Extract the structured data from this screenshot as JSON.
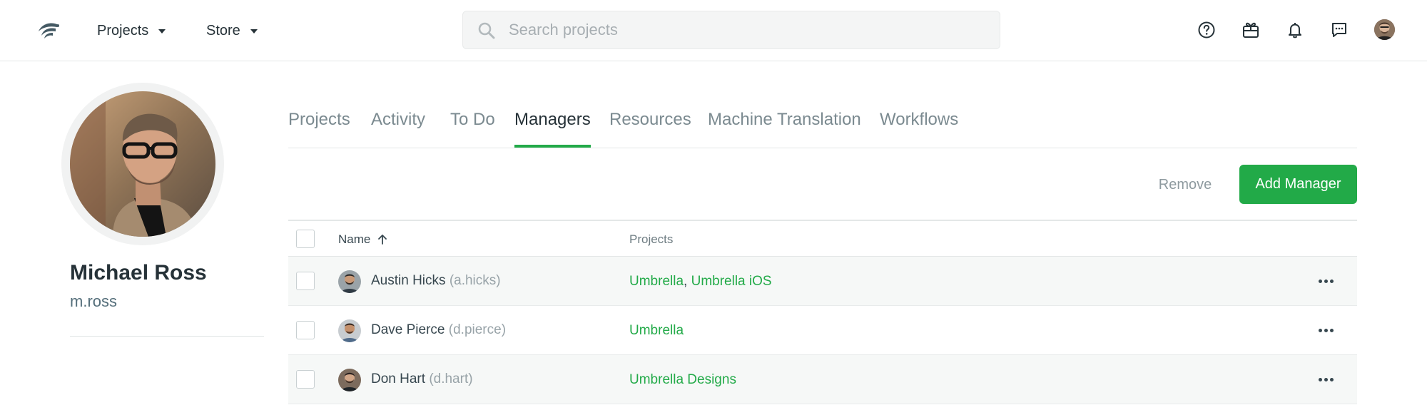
{
  "header": {
    "nav": [
      {
        "label": "Projects"
      },
      {
        "label": "Store"
      }
    ],
    "search": {
      "placeholder": "Search projects"
    },
    "icons": [
      "help-icon",
      "gift-icon",
      "bell-icon",
      "chat-icon"
    ]
  },
  "profile": {
    "name": "Michael Ross",
    "username": "m.ross"
  },
  "tabs": [
    {
      "label": "Projects",
      "active": false
    },
    {
      "label": "Activity",
      "active": false
    },
    {
      "label": "To Do",
      "active": false
    },
    {
      "label": "Managers",
      "active": true
    },
    {
      "label": "Resources",
      "active": false
    },
    {
      "label": "Machine Translation",
      "active": false
    },
    {
      "label": "Workflows",
      "active": false
    }
  ],
  "actions": {
    "remove_label": "Remove",
    "add_label": "Add Manager"
  },
  "table": {
    "columns": {
      "name": "Name",
      "projects": "Projects"
    },
    "sort": "ascending",
    "rows": [
      {
        "name": "Austin Hicks",
        "username": "(a.hicks)",
        "projects": [
          "Umbrella",
          "Umbrella iOS"
        ],
        "separator": ", "
      },
      {
        "name": "Dave Pierce",
        "username": "(d.pierce)",
        "projects": [
          "Umbrella"
        ],
        "separator": ""
      },
      {
        "name": "Don Hart",
        "username": "(d.hart)",
        "projects": [
          "Umbrella Designs"
        ],
        "separator": ""
      }
    ]
  },
  "colors": {
    "accent": "#22aa48",
    "text": "#263238",
    "muted": "#7b8a90"
  }
}
